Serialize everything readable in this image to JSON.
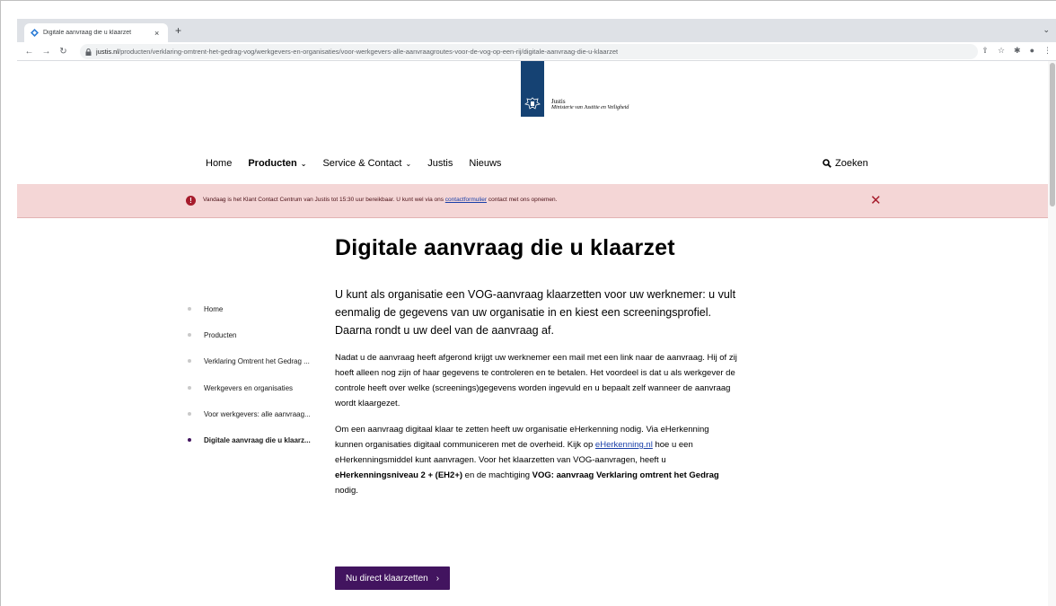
{
  "browser": {
    "tab_title": "Digitale aanvraag die u klaarzet",
    "new_tab": "+",
    "tab_close": "×",
    "tab_menu": "⌄",
    "url_domain": "justis.nl",
    "url_path": "/producten/verklaring-omtrent-het-gedrag-vog/werkgevers-en-organisaties/voor-werkgevers-alle-aanvraagroutes-voor-de-vog-op-een-rij/digitale-aanvraag-die-u-klaarzet"
  },
  "logo": {
    "name": "Justis",
    "subtitle": "Ministerie van Justitie en Veiligheid"
  },
  "nav": {
    "items": [
      {
        "label": "Home",
        "dropdown": false,
        "active": false
      },
      {
        "label": "Producten",
        "dropdown": true,
        "active": true
      },
      {
        "label": "Service & Contact",
        "dropdown": true,
        "active": false
      },
      {
        "label": "Justis",
        "dropdown": false,
        "active": false
      },
      {
        "label": "Nieuws",
        "dropdown": false,
        "active": false
      }
    ],
    "search_label": "Zoeken"
  },
  "alert": {
    "text_before": "Vandaag is het Klant Contact Centrum van Justis tot 15:30 uur bereikbaar. U kunt wel via ons ",
    "link": "contactformulier",
    "text_after": " contact met ons opnemen.",
    "close": "✕"
  },
  "breadcrumb": [
    {
      "label": "Home",
      "active": false
    },
    {
      "label": "Producten",
      "active": false
    },
    {
      "label": "Verklaring Omtrent het Gedrag ...",
      "active": false
    },
    {
      "label": "Werkgevers en organisaties",
      "active": false
    },
    {
      "label": "Voor werkgevers: alle aanvraag...",
      "active": false
    },
    {
      "label": "Digitale aanvraag die u klaarz...",
      "active": true
    }
  ],
  "main": {
    "title": "Digitale aanvraag die u klaarzet",
    "lead": "U kunt als organisatie een VOG-aanvraag klaarzetten voor uw werknemer: u vult eenmalig de gegevens van uw organisatie in en kiest een screeningsprofiel. Daarna rondt u uw deel van de aanvraag af.",
    "para1": "Nadat u de aanvraag heeft afgerond  krijgt uw werknemer een mail met een link naar de aanvraag. Hij of zij hoeft alleen nog zijn of haar gegevens te controleren en te betalen. Het voordeel is dat u als werkgever de controle heeft over welke (screenings)gegevens worden ingevuld en u bepaalt zelf wanneer de aanvraag wordt klaargezet.",
    "para2_a": "Om een aanvraag digitaal klaar te zetten heeft uw organisatie eHerkenning nodig. Via eHerkenning kunnen organisaties digitaal communiceren met de overheid. Kijk op ",
    "para2_link": "eHerkenning.nl",
    "para2_b": " hoe u een eHerkenningsmiddel kunt aanvragen. Voor het klaarzetten van VOG-aanvragen, heeft u ",
    "para2_bold1": "eHerkenningsniveau 2 + (EH2+)",
    "para2_c": " en de machtiging ",
    "para2_bold2": "VOG: aanvraag Verklaring omtrent het Gedrag",
    "para2_d": " nodig.",
    "cta_label": "Nu direct klaarzetten",
    "cta_arrow": "›"
  },
  "colors": {
    "brand_purple": "#42145f",
    "rijksoverheid_blue": "#154273",
    "alert_bg": "#f4d6d6",
    "alert_icon": "#a61c2c"
  }
}
